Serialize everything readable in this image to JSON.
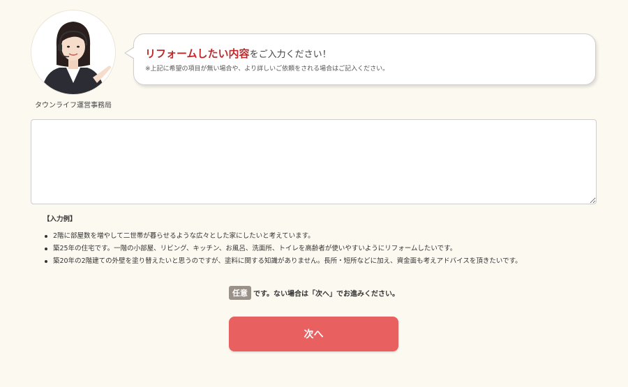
{
  "operator": {
    "label": "タウンライフ運営事務局"
  },
  "bubble": {
    "title_highlight": "リフォームしたい内容",
    "title_rest": "をご入力ください！",
    "note": "※上記に希望の項目が無い場合や、より詳しいご依頼をされる場合はご記入ください。"
  },
  "form": {
    "textarea_value": "",
    "textarea_placeholder": ""
  },
  "examples": {
    "title": "【入力例】",
    "items": [
      "2階に部屋数を増やして二世帯が暮らせるような広々とした家にしたいと考えています。",
      "築25年の住宅です。一階の小部屋、リビング、キッチン、お風呂、洗面所、トイレを高齢者が使いやすいようにリフォームしたいです。",
      "築20年の2階建ての外壁を塗り替えたいと思うのですが、塗料に関する知識がありません。長所・短所などに加え、資金面も考えアドバイスを頂きたいです。"
    ]
  },
  "optional": {
    "badge": "任意",
    "text": "です。ない場合は「次へ」でお進みください。"
  },
  "next_button": {
    "label": "次へ"
  },
  "colors": {
    "background": "#fcf9f0",
    "accent_red": "#c0282a",
    "button": "#e86060",
    "badge": "#9a9188"
  }
}
